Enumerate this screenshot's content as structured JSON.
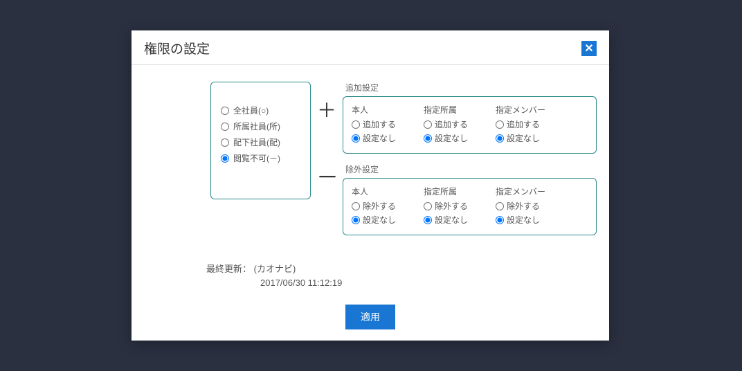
{
  "modal": {
    "title": "権限の設定",
    "close": "✕"
  },
  "leftOptions": {
    "opt1": "全社員(○)",
    "opt2": "所属社員(所)",
    "opt3": "配下社員(配)",
    "opt4": "閲覧不可(－)"
  },
  "addSection": {
    "label": "追加設定",
    "col1": {
      "title": "本人",
      "opt1": "追加する",
      "opt2": "設定なし"
    },
    "col2": {
      "title": "指定所属",
      "opt1": "追加する",
      "opt2": "設定なし"
    },
    "col3": {
      "title": "指定メンバー",
      "opt1": "追加する",
      "opt2": "設定なし"
    }
  },
  "removeSection": {
    "label": "除外設定",
    "col1": {
      "title": "本人",
      "opt1": "除外する",
      "opt2": "設定なし"
    },
    "col2": {
      "title": "指定所属",
      "opt1": "除外する",
      "opt2": "設定なし"
    },
    "col3": {
      "title": "指定メンバー",
      "opt1": "除外する",
      "opt2": "設定なし"
    }
  },
  "plus": "＋",
  "minus": "－",
  "updateLabel": "最終更新：  (カオナビ)",
  "updateTimestamp": "2017/06/30 11:12:19",
  "applyLabel": "適用"
}
